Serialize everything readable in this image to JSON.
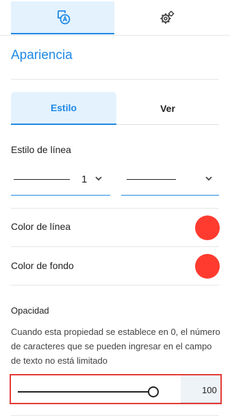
{
  "tabs": {
    "appearance_icon": "text-style-icon",
    "settings_icon": "gear-icon"
  },
  "panel": {
    "title": "Apariencia"
  },
  "segmented": {
    "style_label": "Estilo",
    "view_label": "Ver"
  },
  "line_style": {
    "label": "Estilo de línea",
    "width_value": "1"
  },
  "line_color": {
    "label": "Color de línea",
    "value": "#ff3b2f"
  },
  "bg_color": {
    "label": "Color de fondo",
    "value": "#ff3b2f"
  },
  "opacity": {
    "label": "Opacidad",
    "description": "Cuando esta propiedad se establece en 0, el número de caracteres que se pueden ingresar en el campo de texto no está limitado",
    "value": "100",
    "level": 100
  },
  "colors": {
    "accent": "#1e88e5",
    "accent_bg": "#e3f2fd",
    "swatch": "#ff3b2f",
    "highlight": "#e53935"
  }
}
